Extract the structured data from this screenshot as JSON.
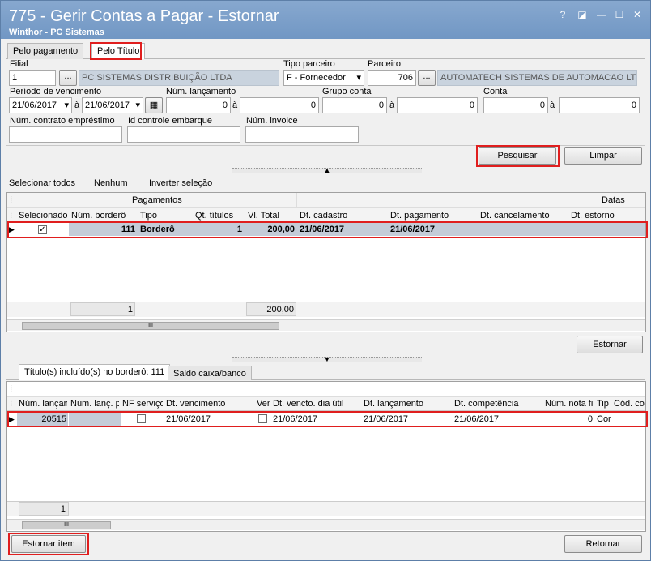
{
  "window": {
    "title": "775 - Gerir Contas a Pagar - Estornar",
    "subtitle": "Winthor - PC Sistemas",
    "help": "?",
    "restore": "◪",
    "minimize": "—",
    "maximize": "☐",
    "close": "✕"
  },
  "tabs": {
    "pagamento": "Pelo pagamento",
    "titulo": "Pelo Título"
  },
  "filters": {
    "filial_label": "Filial",
    "filial_value": "1",
    "filial_name": "PC SISTEMAS DISTRIBUIÇÃO LTDA",
    "tipo_parceiro_label": "Tipo parceiro",
    "tipo_parceiro_value": "F - Fornecedor",
    "parceiro_label": "Parceiro",
    "parceiro_value": "706",
    "parceiro_name": "AUTOMATECH SISTEMAS DE AUTOMACAO LTDA",
    "periodo_label": "Período de vencimento",
    "periodo_de": "21/06/2017",
    "periodo_ate": "21/06/2017",
    "a": "à",
    "lanc_label": "Núm. lançamento",
    "lanc_de": "0",
    "lanc_ate": "0",
    "grupo_label": "Grupo conta",
    "grupo_de": "0",
    "grupo_ate": "0",
    "conta_label": "Conta",
    "conta_de": "0",
    "conta_ate": "0",
    "contrato_label": "Núm. contrato empréstimo",
    "embarque_label": "Id controle embarque",
    "invoice_label": "Núm. invoice",
    "ellipsis": "..."
  },
  "actions": {
    "pesquisar": "Pesquisar",
    "limpar": "Limpar",
    "estornar": "Estornar",
    "estornar_item": "Estornar item",
    "retornar": "Retornar"
  },
  "selection": {
    "todos": "Selecionar todos",
    "nenhum": "Nenhum",
    "inverter": "Inverter seleção"
  },
  "grid1": {
    "group_pagamentos": "Pagamentos",
    "group_datas": "Datas",
    "columns": [
      "Selecionado",
      "Núm. borderô",
      "Tipo",
      "Qt. títulos",
      "Vl. Total",
      "Dt. cadastro",
      "Dt. pagamento",
      "Dt. cancelamento",
      "Dt. estorno"
    ],
    "row": {
      "num": "111",
      "tipo": "Borderô",
      "qt": "1",
      "total": "200,00",
      "cadastro": "21/06/2017",
      "pagamento": "21/06/2017"
    },
    "footer": {
      "count": "1",
      "total": "200,00"
    }
  },
  "bottom_tabs": {
    "titulos": "Título(s) incluído(s) no borderô: 111",
    "saldo": "Saldo caixa/banco"
  },
  "grid2": {
    "columns": [
      "Núm. lançam",
      "Núm. lanç. p",
      "NF serviço",
      "Dt. vencimento",
      "Ven",
      "Dt. vencto. dia útil",
      "Dt. lançamento",
      "Dt. competência",
      "Núm. nota fi",
      "Tip",
      "Cód. con"
    ],
    "row": {
      "lanc": "20515",
      "venc": "21/06/2017",
      "util": "21/06/2017",
      "lancto": "21/06/2017",
      "comp": "21/06/2017",
      "nota": "0",
      "tip": "Cor"
    },
    "footer": {
      "count": "1"
    }
  },
  "misc": {
    "row_marker": "▶",
    "check": "✓",
    "dropdown": "▾",
    "grip": "⁞",
    "thumb": "III",
    "up": "▲",
    "down": "▼",
    "cal": "▦"
  }
}
